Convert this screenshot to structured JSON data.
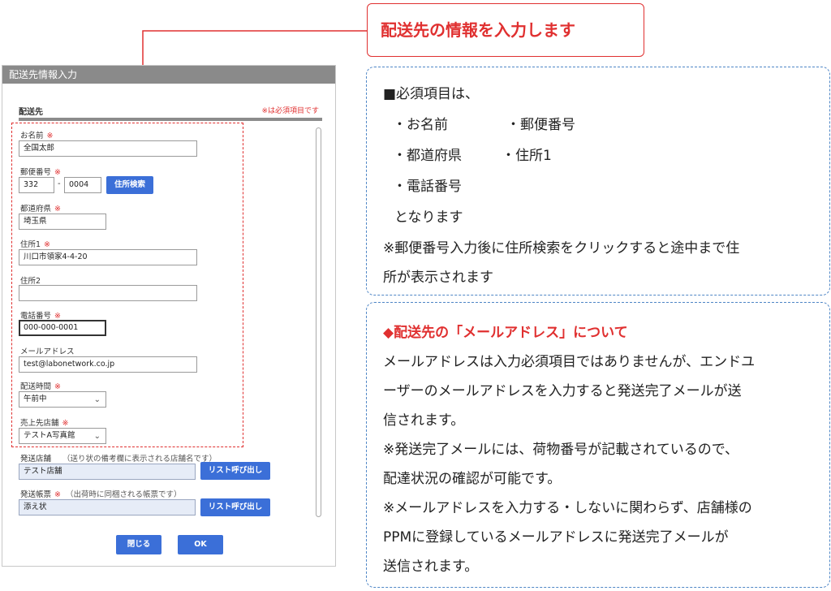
{
  "callout": {
    "text": "配送先の情報を入力します",
    "color": "#e03030"
  },
  "dialog": {
    "title": "配送先情報入力",
    "section_title": "配送先",
    "required_note": "※は必須項目です",
    "required_mark": "※",
    "name": {
      "label": "お名前",
      "value": "全国太郎"
    },
    "postal": {
      "label": "郵便番号",
      "value1": "332",
      "separator": "-",
      "value2": "0004",
      "search_button": "住所検索"
    },
    "prefecture": {
      "label": "都道府県",
      "value": "埼玉県"
    },
    "address1": {
      "label": "住所1",
      "value": "川口市領家4-4-20"
    },
    "address2": {
      "label": "住所2",
      "value": ""
    },
    "phone": {
      "label": "電話番号",
      "value": "000-000-0001"
    },
    "email": {
      "label": "メールアドレス",
      "value": "test@labonetwork.co.jp"
    },
    "delivery_time": {
      "label": "配送時間",
      "value": "午前中"
    },
    "sales_store": {
      "label": "売上先店舗",
      "value": "テストA写真館"
    },
    "shipping_store": {
      "label": "発送店舗",
      "hint": "（送り状の備考欄に表示される店舗名です）",
      "value": "テスト店舗",
      "button": "リスト呼び出し"
    },
    "shipping_form": {
      "label": "発送帳票",
      "hint": "（出荷時に同梱される帳票です）",
      "value": "添え状",
      "button": "リスト呼び出し"
    },
    "close_button": "閉じる",
    "ok_button": "OK",
    "accent_color": "#3b6fd8"
  },
  "info1": {
    "line1": "■必須項目は、",
    "item_name": "・お名前",
    "item_postal": "・郵便番号",
    "item_prefecture": "・都道府県",
    "item_address1": "・住所1",
    "item_phone": "・電話番号",
    "line_end": "となります",
    "note1": "※郵便番号入力後に住所検索をクリックすると途中まで住",
    "note2": "所が表示されます"
  },
  "info2": {
    "title": "◆配送先の「メールアドレス」について",
    "p1": "メールアドレスは入力必須項目ではありませんが、エンドユ",
    "p2": "ーザーのメールアドレスを入力すると発送完了メールが送",
    "p3": "信されます。",
    "p4": "※発送完了メールには、荷物番号が記載されているので、",
    "p5": "配達状況の確認が可能です。",
    "p6": "※メールアドレスを入力する・しないに関わらず、店舗様の",
    "p7": "PPMに登録しているメールアドレスに発送完了メールが",
    "p8": "送信されます。"
  }
}
